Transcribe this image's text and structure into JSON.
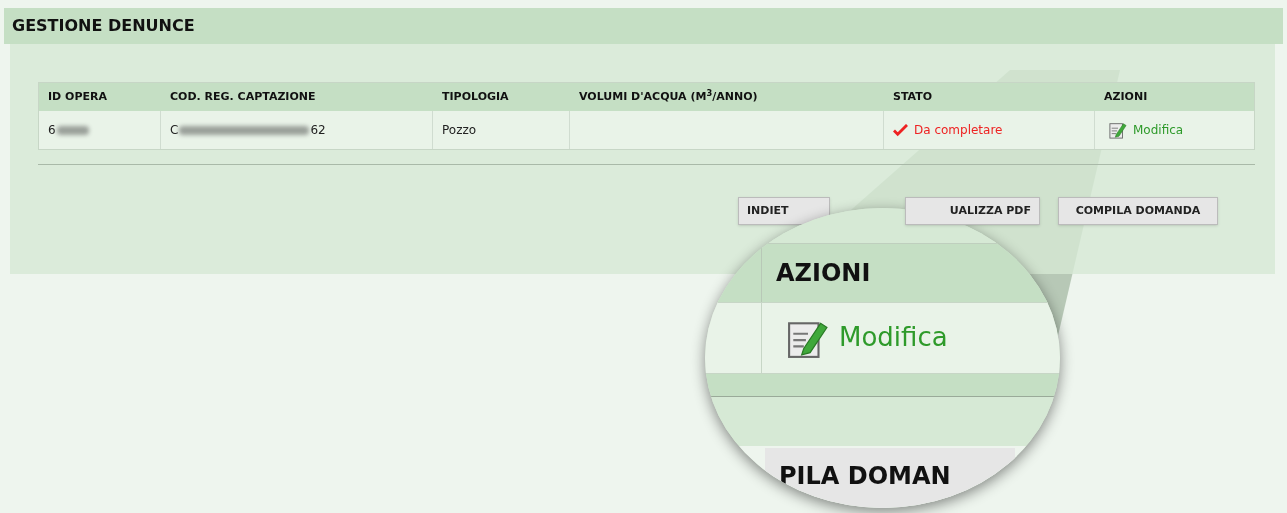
{
  "title": "GESTIONE DENUNCE",
  "table": {
    "columns": [
      "ID OPERA",
      "COD. REG. CAPTAZIONE",
      "TIPOLOGIA",
      "VOLUMI D'ACQUA (M$^{3}$/ANNO)",
      "STATO",
      "AZIONI"
    ],
    "rows": [
      {
        "id_opera": {
          "start": "6"
        },
        "cod_reg": {
          "start": "C",
          "end": "62"
        },
        "tipologia": "Pozzo",
        "stato": {
          "kind": "check",
          "label": "Da completare",
          "color": "#ee2222"
        },
        "azione": "Modifica"
      }
    ]
  },
  "buttons": [
    "INDIET",
    "UALIZZA PDF",
    "COMPILA DOMANDA"
  ],
  "magnifier": {
    "header": "AZIONI",
    "action": "Modifica",
    "button": "PILA DOMAN"
  }
}
